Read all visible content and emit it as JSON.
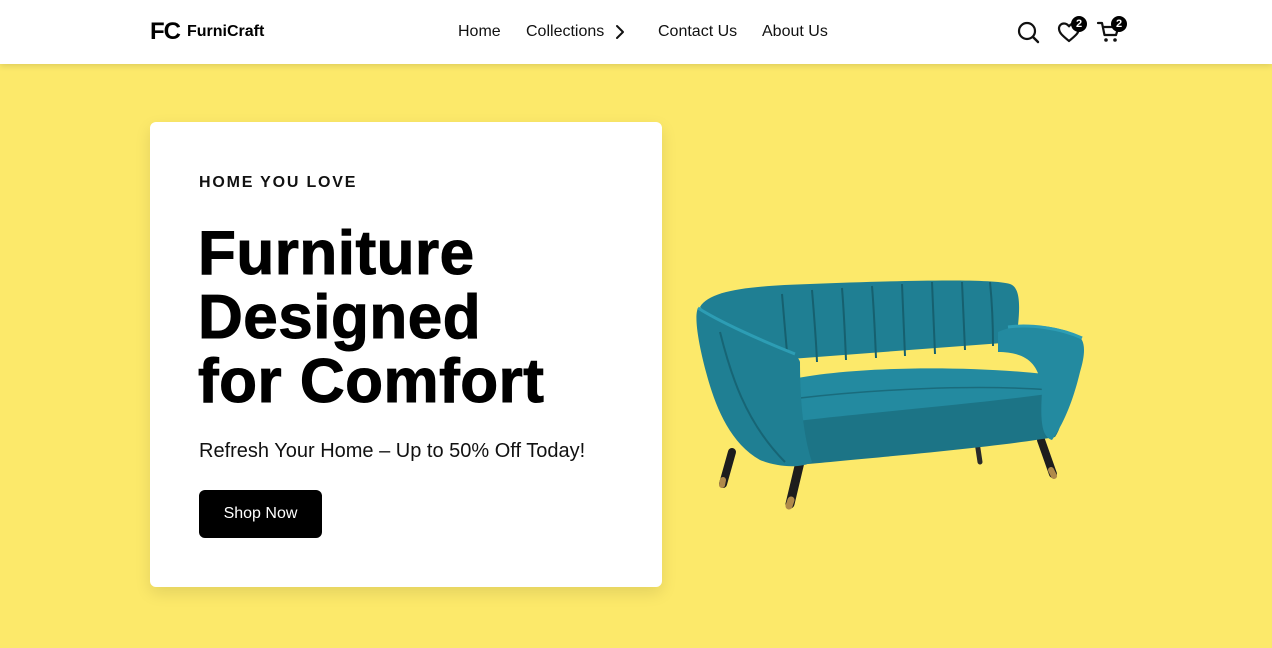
{
  "brand": {
    "mark": "FC",
    "name": "FurniCraft"
  },
  "nav": {
    "home": "Home",
    "collections": "Collections",
    "contact": "Contact Us",
    "about": "About Us"
  },
  "header_icons": {
    "search": "search-icon",
    "wishlist": {
      "icon": "heart-icon",
      "count": "2"
    },
    "cart": {
      "icon": "cart-icon",
      "count": "2"
    }
  },
  "hero": {
    "eyebrow": "HOME YOU LOVE",
    "title_lines": [
      "Furniture",
      "Designed",
      "for Comfort"
    ],
    "subtitle": "Refresh Your Home – Up to 50% Off Today!",
    "cta": "Shop Now",
    "image": "teal-sofa"
  },
  "colors": {
    "hero_background": "#fce96a",
    "sofa": "#1f7f93",
    "button": "#000000"
  }
}
